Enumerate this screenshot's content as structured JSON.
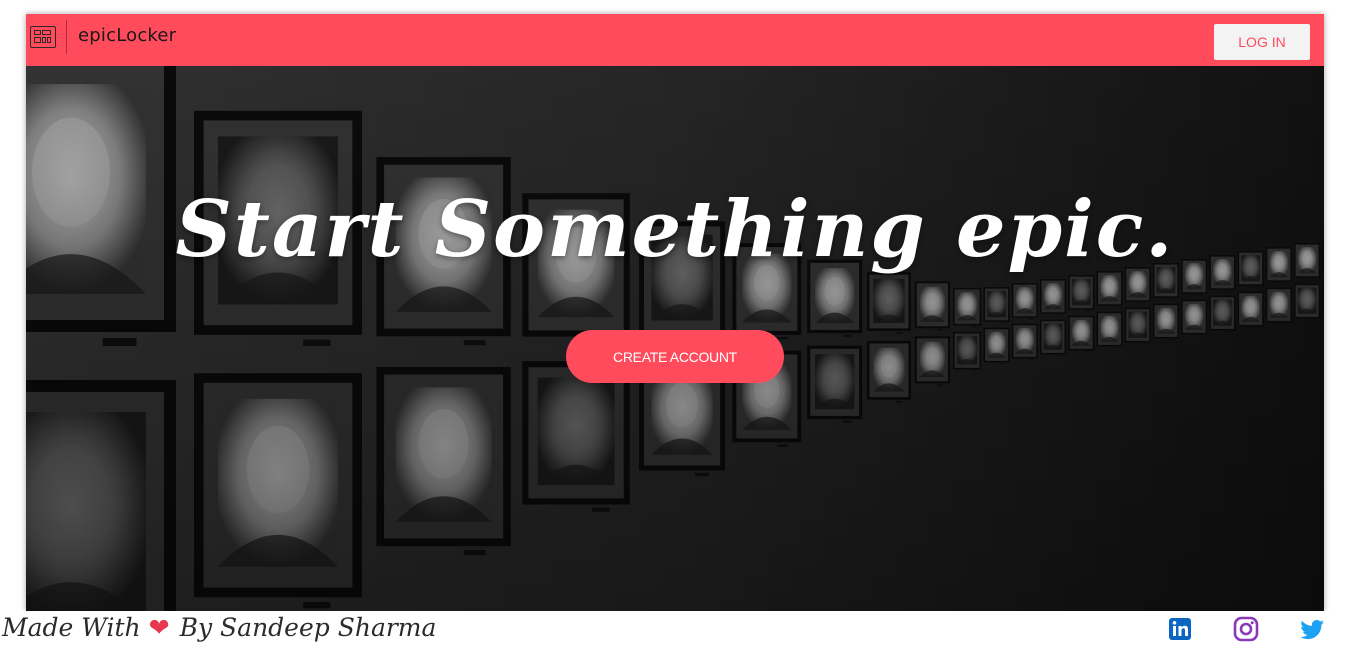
{
  "navbar": {
    "brand": "epicLocker",
    "login_label": "LOG IN",
    "logo_icon": "locker-grid-icon"
  },
  "hero": {
    "title": "Start Something epic.",
    "create_account_label": "CREATE ACCOUNT",
    "background": "black-and-white wall of framed portrait photographs"
  },
  "footer": {
    "credit_prefix": "Made With",
    "credit_suffix": "By Sandeep Sharma",
    "heart_icon": "heart-icon",
    "social": [
      {
        "name": "linkedin-icon"
      },
      {
        "name": "instagram-icon"
      },
      {
        "name": "twitter-icon"
      }
    ]
  },
  "colors": {
    "accent": "#ff4b5c",
    "login_bg": "#f3f3f3",
    "linkedin": "#0a66c2",
    "instagram": "#8a3ab9",
    "twitter": "#1da1f2"
  }
}
